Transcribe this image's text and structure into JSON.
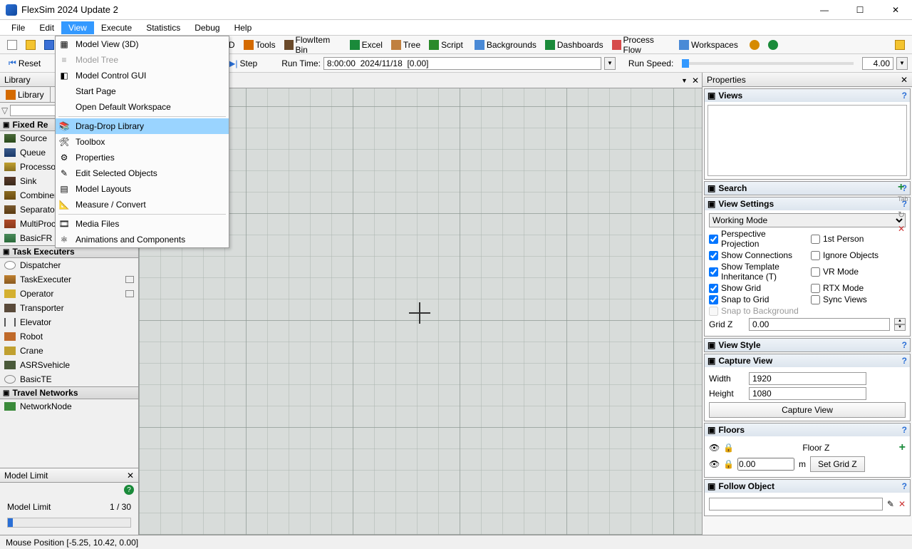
{
  "window": {
    "title": "FlexSim 2024 Update 2"
  },
  "menubar": [
    "File",
    "Edit",
    "View",
    "Execute",
    "Statistics",
    "Debug",
    "Help"
  ],
  "menubar_active": "View",
  "view_menu": [
    {
      "label": "Model View (3D)",
      "icon": "grid"
    },
    {
      "label": "Model Tree",
      "icon": "tree",
      "disabled": true
    },
    {
      "label": "Model Control GUI",
      "icon": "gui"
    },
    {
      "label": "Start Page",
      "icon": ""
    },
    {
      "label": "Open Default Workspace",
      "icon": ""
    },
    {
      "sep": true
    },
    {
      "label": "Drag-Drop Library",
      "icon": "lib",
      "hi": true
    },
    {
      "label": "Toolbox",
      "icon": "tools"
    },
    {
      "label": "Properties",
      "icon": "props"
    },
    {
      "label": "Edit Selected Objects",
      "icon": "edit"
    },
    {
      "label": "Model Layouts",
      "icon": "layouts"
    },
    {
      "label": "Measure / Convert",
      "icon": "measure"
    },
    {
      "sep": true
    },
    {
      "label": "Media Files",
      "icon": "media"
    },
    {
      "label": "Animations and Components",
      "icon": "anim"
    }
  ],
  "toolbar": {
    "d3": "3D",
    "tools": "Tools",
    "flowitem": "FlowItem Bin",
    "excel": "Excel",
    "tree": "Tree",
    "script": "Script",
    "backgrounds": "Backgrounds",
    "dashboards": "Dashboards",
    "processflow": "Process Flow",
    "workspaces": "Workspaces"
  },
  "runbar": {
    "reset": "Reset",
    "step": "Step",
    "runtime_label": "Run Time:",
    "runtime_value": "8:00:00  2024/11/18  [0.00]",
    "runspeed_label": "Run Speed:",
    "runspeed_value": "4.00"
  },
  "library": {
    "title": "Library",
    "tab": "Library",
    "sections": [
      {
        "name": "Fixed Re",
        "items": [
          "Source",
          "Queue",
          "Processor",
          "Sink",
          "Combiner",
          "Separator",
          "MultiProcessor",
          "BasicFR"
        ]
      },
      {
        "name": "Task Executers",
        "items": [
          "Dispatcher",
          "TaskExecuter",
          "Operator",
          "Transporter",
          "Elevator",
          "Robot",
          "Crane",
          "ASRSvehicle",
          "BasicTE"
        ]
      },
      {
        "name": "Travel Networks",
        "items": [
          "NetworkNode"
        ]
      }
    ]
  },
  "model_limit": {
    "title": "Model Limit",
    "label": "Model Limit",
    "value": "1 / 30"
  },
  "properties": {
    "title": "Properties",
    "views": "Views",
    "search": "Search",
    "view_settings": "View Settings",
    "working_mode": "Working Mode",
    "checks": {
      "perspective": "Perspective Projection",
      "firstperson": "1st Person",
      "connections": "Show Connections",
      "ignore": "Ignore Objects",
      "template": "Show Template Inheritance (T)",
      "vr": "VR Mode",
      "grid": "Show Grid",
      "rtx": "RTX Mode",
      "snap": "Snap to Grid",
      "sync": "Sync Views",
      "snapbg": "Snap to Background"
    },
    "gridz_label": "Grid Z",
    "gridz_value": "0.00",
    "view_style": "View Style",
    "capture": "Capture View",
    "width_label": "Width",
    "width_value": "1920",
    "height_label": "Height",
    "height_value": "1080",
    "capture_btn": "Capture View",
    "floors": "Floors",
    "floorz_label": "Floor Z",
    "floor_value": "0.00",
    "floor_unit": "m",
    "setgridz": "Set Grid Z",
    "follow": "Follow Object"
  },
  "status": {
    "mouse": "Mouse Position [-5.25, 10.42, 0.00]"
  }
}
